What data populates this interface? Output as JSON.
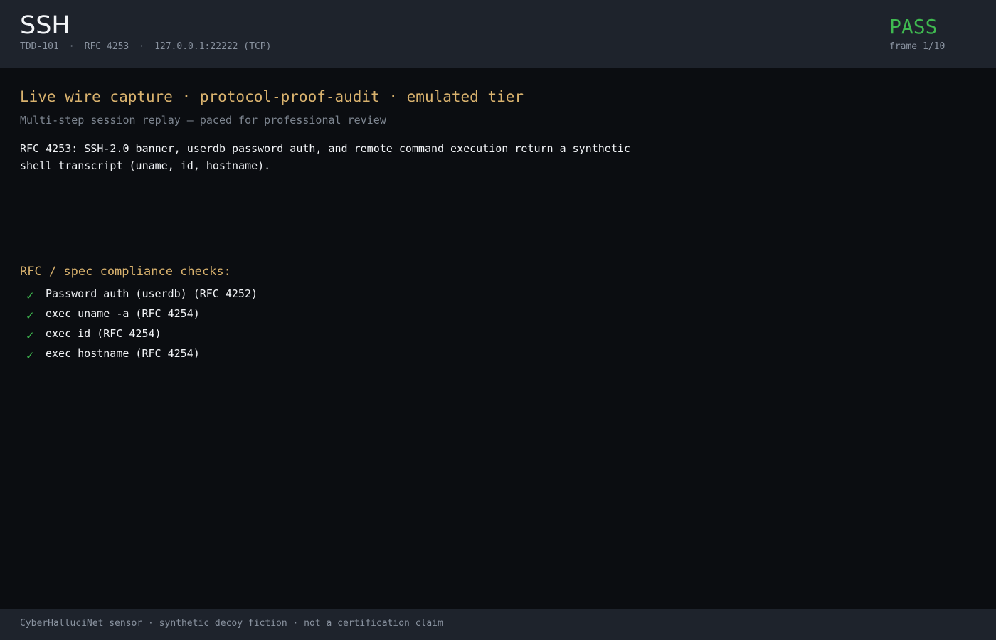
{
  "header": {
    "title": "SSH",
    "meta": {
      "ticket": "TDD-101",
      "rfc": "RFC 4253",
      "endpoint": "127.0.0.1:22222 (TCP)",
      "separator": "·"
    },
    "status": "PASS",
    "frame": "frame 1/10"
  },
  "main": {
    "headline": "Live wire capture · protocol-proof-audit · emulated tier",
    "subline": "Multi-step session replay — paced for professional review",
    "description": "RFC 4253: SSH-2.0 banner, userdb password auth, and remote command execution return a synthetic shell transcript (uname, id, hostname).",
    "checks_title": "RFC / spec compliance checks:",
    "checks": [
      {
        "mark": "✓",
        "label": "Password auth (userdb) (RFC 4252)"
      },
      {
        "mark": "✓",
        "label": "exec uname -a (RFC 4254)"
      },
      {
        "mark": "✓",
        "label": "exec id (RFC 4254)"
      },
      {
        "mark": "✓",
        "label": "exec hostname (RFC 4254)"
      }
    ]
  },
  "footer": {
    "text": "CyberHalluciNet sensor · synthetic decoy fiction · not a certification claim"
  },
  "colors": {
    "background": "#0b0d11",
    "panel": "#1e232c",
    "accent": "#d9b26e",
    "pass": "#3fb950",
    "muted": "#8a93a0"
  }
}
